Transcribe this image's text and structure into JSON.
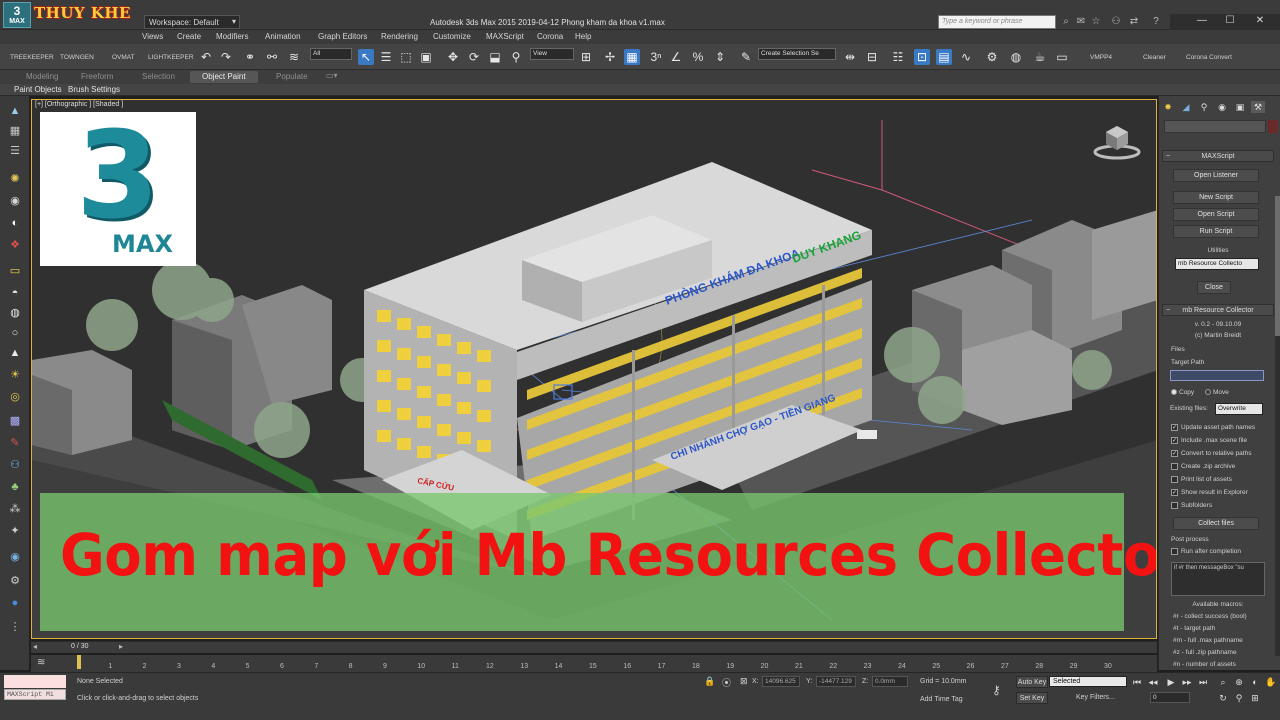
{
  "titlebar": {
    "app_icon_line1": "3",
    "app_icon_line2": "MAX",
    "brand": "THUY KHE",
    "workspace": "Workspace: Default",
    "title": "Autodesk 3ds Max  2015     2019-04-12 Phong kham da khoa v1.max",
    "search_placeholder": "Type a keyword or phrase",
    "minimize": "—",
    "maximize": "☐",
    "close": "✕"
  },
  "menu": [
    "Views",
    "Create",
    "Modifiers",
    "Animation",
    "Graph Editors",
    "Rendering",
    "Customize",
    "MAXScript",
    "Corona",
    "Help"
  ],
  "toolbar": {
    "left_labels": [
      "TREEKEEPER",
      "TOWNGEN",
      "OVMAT",
      "LIGHTKEEPER"
    ],
    "filter_select": "All",
    "view_select": "View",
    "selection_set": "Create Selection Se",
    "right_labels": [
      "VMPP4",
      "Cleaner",
      "Corona Convert"
    ]
  },
  "ribbon": {
    "tabs": [
      "Modeling",
      "Freeform",
      "Selection",
      "Object Paint",
      "Populate"
    ],
    "active_tab": "Object Paint",
    "subitems": [
      "Paint Objects",
      "Brush Settings"
    ]
  },
  "viewport": {
    "label": "[+] [Orthographic ] [Shaded ]",
    "logo_number": "3",
    "logo_word": "MAX",
    "sign_top": "PHÒNG KHÁM ĐA KHOA",
    "sign_top_highlight": "DUY KHANG",
    "sign_bottom": "CHI NHÁNH CHỢ GẠO - TIỀN GIANG",
    "sign_entrance": "CẤP CỨU",
    "banner": "Gom map với Mb Resources Collector"
  },
  "command_panel": {
    "maxscript_title": "MAXScript",
    "buttons": [
      "Open Listener",
      "New Script",
      "Open Script",
      "Run Script"
    ],
    "utilities_label": "Utilities",
    "utilities_select": "mb Resource Collecto",
    "close_button": "Close",
    "collector_title": "mb Resource Collector",
    "version": "v. 0.2 - 09.10.09",
    "author": "(c) Martin Breidt",
    "files_label": "Files",
    "target_path_label": "Target Path",
    "copy_label": "Copy",
    "move_label": "Move",
    "existing_files_label": "Existing files:",
    "existing_files_select": "Overwrite",
    "options": [
      {
        "label": "Update asset path names",
        "checked": true
      },
      {
        "label": "Include .max scene file",
        "checked": true
      },
      {
        "label": "Convert to relative paths",
        "checked": true
      },
      {
        "label": "Create .zip archive",
        "checked": false
      },
      {
        "label": "Print list of assets",
        "checked": false
      },
      {
        "label": "Show result in Explorer",
        "checked": true
      },
      {
        "label": "Subfolders",
        "checked": false
      }
    ],
    "collect_button": "Collect files",
    "post_process_label": "Post process",
    "run_after_label": "Run after completion",
    "script_box_text": "if #r then messageBox \"su",
    "macros_title": "Available macros:",
    "macros": [
      "#r - collect success (bool)",
      "#t - target path",
      "#m - full .max pathname",
      "#z - full .zip pathname",
      "#n - number of assets"
    ]
  },
  "timeline": {
    "readout": "0 / 30",
    "ticks": [
      "0",
      "1",
      "2",
      "3",
      "4",
      "5",
      "6",
      "7",
      "8",
      "9",
      "10",
      "11",
      "12",
      "13",
      "14",
      "15",
      "16",
      "17",
      "18",
      "19",
      "20",
      "21",
      "22",
      "23",
      "24",
      "25",
      "26",
      "27",
      "28",
      "29",
      "30"
    ]
  },
  "status": {
    "maxscript_mini": "MAXScript Mi",
    "selection_info": "None Selected",
    "prompt": "Click or click-and-drag to select objects",
    "x_label": "X:",
    "x_value": "14096.625",
    "y_label": "Y:",
    "y_value": "-14477.129",
    "z_label": "Z:",
    "z_value": "0.0mm",
    "grid": "Grid = 10.0mm",
    "add_time_tag": "Add Time Tag",
    "auto_key": "Auto Key",
    "set_key": "Set Key",
    "selected_dropdown": "Selected",
    "key_filters": "Key Filters...",
    "frame_field": "0"
  },
  "colors": {
    "accent_blue": "#3a79c4",
    "viewport_border": "#e0b23a",
    "banner_text": "#f21212",
    "banner_bg": "#78c86e",
    "sign_blue": "#2a56c9",
    "sign_green": "#1aa33a"
  }
}
